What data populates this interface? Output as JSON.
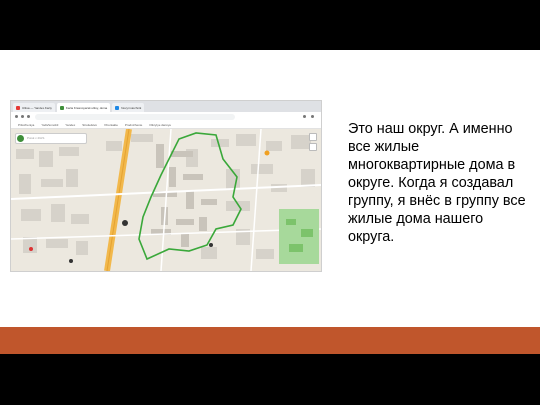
{
  "slide": {
    "caption": "Это наш округ. А именно все жилые многоквартирные дома в округе. Когда я создавал группу, я внёс в группу все жилые дома нашего округа.",
    "colors": {
      "background": "#000000",
      "content": "#ffffff",
      "accent_bar": "#c0562c"
    }
  },
  "screenshot": {
    "tabs": [
      {
        "label": "Ulitsa — Yandex.Karty",
        "icon": "yandex-icon"
      },
      {
        "label": "Karta Krasnoyarsk ulitsy, doma",
        "icon": "2gis-icon"
      },
      {
        "label": "Novyi istochnik",
        "icon": "page-icon"
      }
    ],
    "bookmarks": [
      "Prilozheniya",
      "YaAVtomobil",
      "Yandex",
      "Stroitelstvo",
      "VKontakte",
      "Prodvizhenie",
      "Otkrytye dannye"
    ],
    "search_placeholder": "Poisk v 2GIS"
  }
}
